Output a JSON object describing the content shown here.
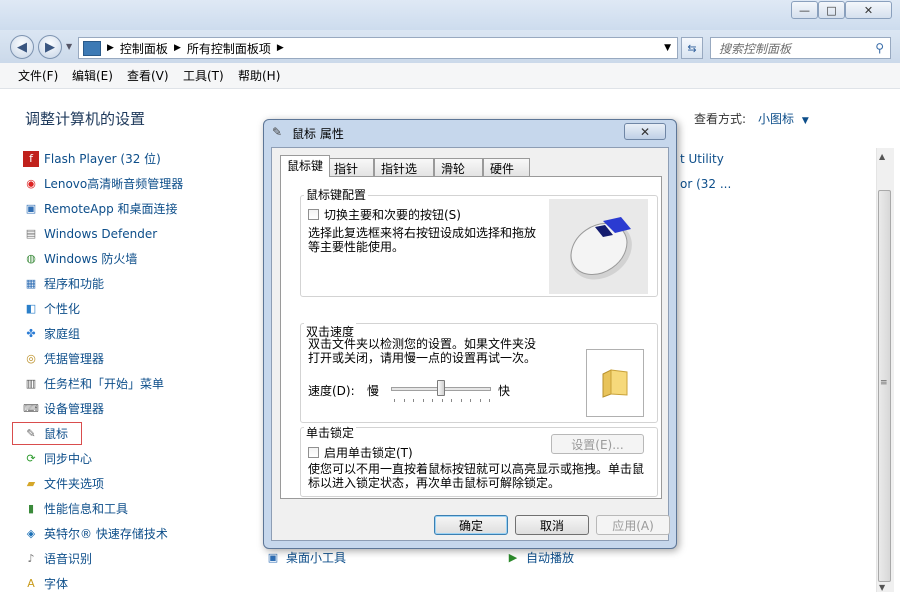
{
  "window": {
    "minimize_glyph": "—",
    "maximize_glyph": "□",
    "close_glyph": "✕"
  },
  "address": {
    "crumb_1": "控制面板",
    "crumb_2": "所有控制面板项",
    "search_placeholder": "搜索控制面板"
  },
  "menubar": [
    "文件(F)",
    "编辑(E)",
    "查看(V)",
    "工具(T)",
    "帮助(H)"
  ],
  "content": {
    "title": "调整计算机的设置",
    "view_label": "查看方式:",
    "view_value": "小图标",
    "left_items": [
      "Flash Player (32 位)",
      "Lenovo高清晰音频管理器",
      "RemoteApp 和桌面连接",
      "Windows Defender",
      "Windows 防火墙",
      "程序和功能",
      "个性化",
      "家庭组",
      "凭据管理器",
      "任务栏和「开始」菜单",
      "设备管理器",
      "鼠标",
      "同步中心",
      "文件夹选项",
      "性能信息和工具",
      "英特尔® 快速存储技术",
      "语音识别",
      "字体"
    ],
    "mid_bottom_item": "桌面小工具",
    "right_items": [
      "t Utility",
      "or (32 ...",
      "自动播放"
    ]
  },
  "dialog": {
    "title": "鼠标 属性",
    "tabs": [
      "鼠标键",
      "指针",
      "指针选项",
      "滑轮",
      "硬件"
    ],
    "group1": {
      "title": "鼠标键配置",
      "checkbox_label": "切换主要和次要的按钮(S)",
      "desc": "选择此复选框来将右按钮设成如选择和拖放等主要性能使用。"
    },
    "group2": {
      "title": "双击速度",
      "desc": "双击文件夹以检测您的设置。如果文件夹没打开或关闭，请用慢一点的设置再试一次。",
      "speed_label": "速度(D):",
      "slow": "慢",
      "fast": "快",
      "speed_level": 0.5
    },
    "group3": {
      "title": "单击锁定",
      "checkbox_label": "启用单击锁定(T)",
      "settings_button": "设置(E)...",
      "desc": "使您可以不用一直按着鼠标按钮就可以高亮显示或拖拽。单击鼠标以进入锁定状态，再次单击鼠标可解除锁定。"
    },
    "buttons": {
      "ok": "确定",
      "cancel": "取消",
      "apply": "应用(A)"
    }
  },
  "colors": {
    "link": "#0d4e8a",
    "title": "#1e395b",
    "selection_outline": "#d94d4d"
  }
}
